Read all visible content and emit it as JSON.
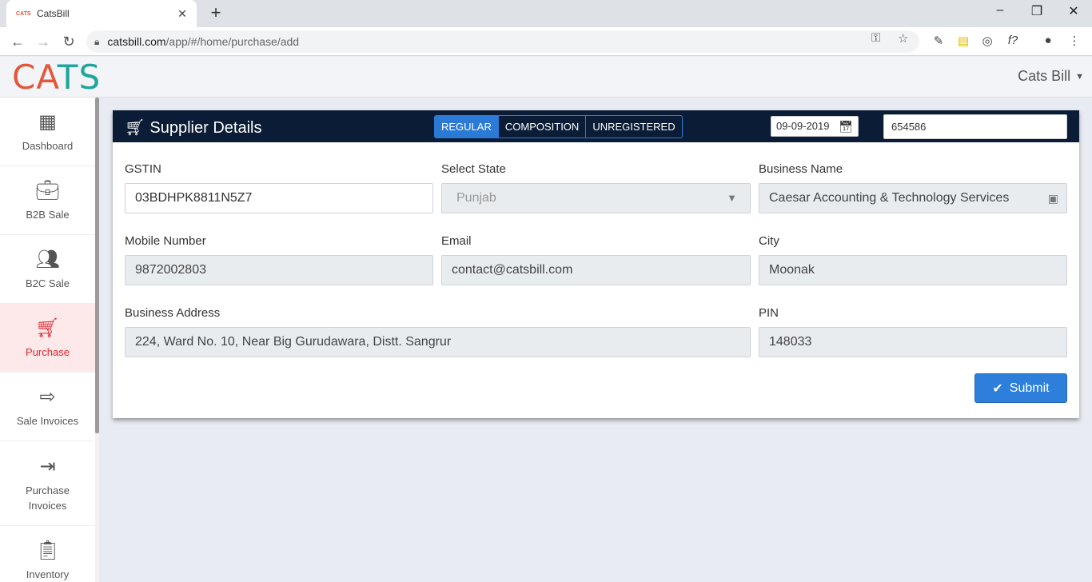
{
  "browser": {
    "tab_title": "CatsBill",
    "tab_favicon": "CATS",
    "new_tab_label": "+",
    "url_host": "catsbill.com",
    "url_path": "/app/#/home/purchase/add",
    "icons": [
      "back-icon",
      "forward-icon",
      "reload-icon",
      "lock-icon",
      "key-icon",
      "star-icon",
      "minimize-icon",
      "maximize-icon",
      "close-icon"
    ]
  },
  "app": {
    "logo_part1": "CA",
    "logo_part2": "TS",
    "user_menu": "Cats Bill",
    "colors": {
      "nav_bg": "#0b1d36",
      "accent": "#2d7fdb",
      "active": "#e0242f"
    }
  },
  "sidebar": {
    "items": [
      {
        "label": "Dashboard",
        "icon": "dashboard-icon"
      },
      {
        "label": "B2B Sale",
        "icon": "briefcase-check-icon"
      },
      {
        "label": "B2C Sale",
        "icon": "people-icon"
      },
      {
        "label": "Purchase",
        "icon": "cart-icon"
      },
      {
        "label": "Sale Invoices",
        "icon": "export-icon"
      },
      {
        "label": "Purchase\nInvoices",
        "label1": "Purchase",
        "label2": "Invoices",
        "icon": "import-icon"
      },
      {
        "label": "Inventory",
        "icon": "clipboard-icon"
      }
    ]
  },
  "supplier": {
    "title": "Supplier Details",
    "types": [
      "REGULAR",
      "COMPOSITION",
      "UNREGISTERED"
    ],
    "selected_type": "REGULAR",
    "date": "09-09-2019",
    "invoice_number": "654586",
    "fields": {
      "gstin": {
        "label": "GSTIN",
        "value": "03BDHPK8811N5Z7"
      },
      "state": {
        "label": "Select State",
        "value": "Punjab"
      },
      "business_name": {
        "label": "Business Name",
        "value": "Caesar Accounting & Technology Services"
      },
      "mobile": {
        "label": "Mobile Number",
        "value": "9872002803"
      },
      "email": {
        "label": "Email",
        "value": "contact@catsbill.com"
      },
      "city": {
        "label": "City",
        "value": "Moonak"
      },
      "address": {
        "label": "Business Address",
        "value": "224, Ward No. 10, Near Big Gurudawara, Distt. Sangrur"
      },
      "pin": {
        "label": "PIN",
        "value": "148033"
      }
    },
    "submit_label": "Submit"
  }
}
